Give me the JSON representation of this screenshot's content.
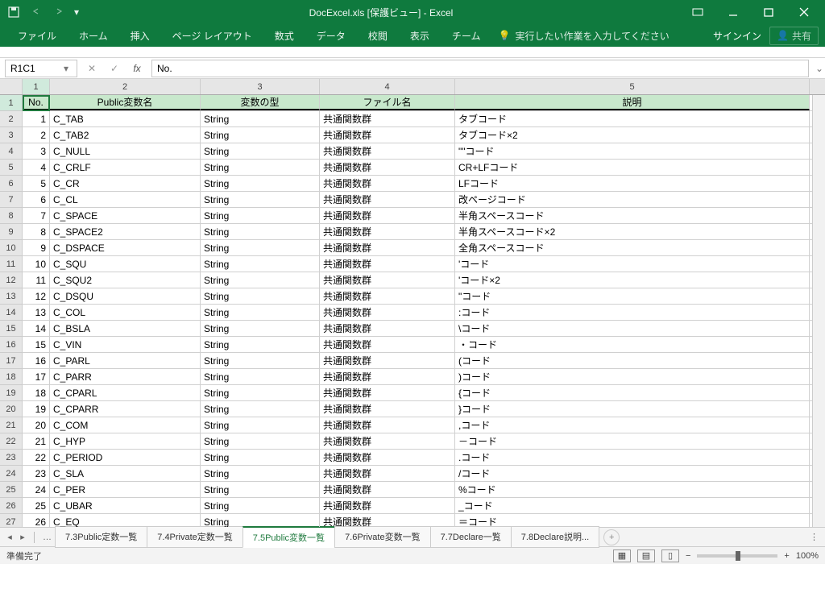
{
  "titlebar": {
    "title": "DocExcel.xls  [保護ビュー]  - Excel"
  },
  "ribbon": {
    "tabs": [
      "ファイル",
      "ホーム",
      "挿入",
      "ページ レイアウト",
      "数式",
      "データ",
      "校閲",
      "表示",
      "チーム"
    ],
    "tell_me": "実行したい作業を入力してください",
    "signin": "サインイン",
    "share": "共有"
  },
  "formula": {
    "namebox": "R1C1",
    "value": "No."
  },
  "cols": [
    "1",
    "2",
    "3",
    "4",
    "5"
  ],
  "headers": [
    "No.",
    "Public変数名",
    "変数の型",
    "ファイル名",
    "説明"
  ],
  "rows": [
    {
      "n": "1",
      "a": "C_TAB",
      "b": "String",
      "c": "共通関数群",
      "d": "タブコード"
    },
    {
      "n": "2",
      "a": "C_TAB2",
      "b": "String",
      "c": "共通関数群",
      "d": "タブコード×2"
    },
    {
      "n": "3",
      "a": "C_NULL",
      "b": "String",
      "c": "共通関数群",
      "d": "\"\"コード"
    },
    {
      "n": "4",
      "a": "C_CRLF",
      "b": "String",
      "c": "共通関数群",
      "d": "CR+LFコード"
    },
    {
      "n": "5",
      "a": "C_CR",
      "b": "String",
      "c": "共通関数群",
      "d": "LFコード"
    },
    {
      "n": "6",
      "a": "C_CL",
      "b": "String",
      "c": "共通関数群",
      "d": "改ページコード"
    },
    {
      "n": "7",
      "a": "C_SPACE",
      "b": "String",
      "c": "共通関数群",
      "d": "半角スペースコード"
    },
    {
      "n": "8",
      "a": "C_SPACE2",
      "b": "String",
      "c": "共通関数群",
      "d": "半角スペースコード×2"
    },
    {
      "n": "9",
      "a": "C_DSPACE",
      "b": "String",
      "c": "共通関数群",
      "d": "全角スペースコード"
    },
    {
      "n": "10",
      "a": "C_SQU",
      "b": "String",
      "c": "共通関数群",
      "d": "'コード"
    },
    {
      "n": "11",
      "a": "C_SQU2",
      "b": "String",
      "c": "共通関数群",
      "d": "'コード×2"
    },
    {
      "n": "12",
      "a": "C_DSQU",
      "b": "String",
      "c": "共通関数群",
      "d": "\"コード"
    },
    {
      "n": "13",
      "a": "C_COL",
      "b": "String",
      "c": "共通関数群",
      "d": ":コード"
    },
    {
      "n": "14",
      "a": "C_BSLA",
      "b": "String",
      "c": "共通関数群",
      "d": "\\コード"
    },
    {
      "n": "15",
      "a": "C_VIN",
      "b": "String",
      "c": "共通関数群",
      "d": "・コード"
    },
    {
      "n": "16",
      "a": "C_PARL",
      "b": "String",
      "c": "共通関数群",
      "d": "(コード"
    },
    {
      "n": "17",
      "a": "C_PARR",
      "b": "String",
      "c": "共通関数群",
      "d": ")コード"
    },
    {
      "n": "18",
      "a": "C_CPARL",
      "b": "String",
      "c": "共通関数群",
      "d": "{コード"
    },
    {
      "n": "19",
      "a": "C_CPARR",
      "b": "String",
      "c": "共通関数群",
      "d": "}コード"
    },
    {
      "n": "20",
      "a": "C_COM",
      "b": "String",
      "c": "共通関数群",
      "d": ",コード"
    },
    {
      "n": "21",
      "a": "C_HYP",
      "b": "String",
      "c": "共通関数群",
      "d": "－コード"
    },
    {
      "n": "22",
      "a": "C_PERIOD",
      "b": "String",
      "c": "共通関数群",
      "d": ".コード"
    },
    {
      "n": "23",
      "a": "C_SLA",
      "b": "String",
      "c": "共通関数群",
      "d": "/コード"
    },
    {
      "n": "24",
      "a": "C_PER",
      "b": "String",
      "c": "共通関数群",
      "d": "%コード"
    },
    {
      "n": "25",
      "a": "C_UBAR",
      "b": "String",
      "c": "共通関数群",
      "d": "_コード"
    },
    {
      "n": "26",
      "a": "C_EQ",
      "b": "String",
      "c": "共通関数群",
      "d": "＝コード"
    }
  ],
  "sheets": [
    "7.3Public定数一覧",
    "7.4Private定数一覧",
    "7.5Public変数一覧",
    "7.6Private変数一覧",
    "7.7Declare一覧",
    "7.8Declare説明..."
  ],
  "active_sheet": 2,
  "status": {
    "ready": "準備完了",
    "zoom": "100%"
  }
}
